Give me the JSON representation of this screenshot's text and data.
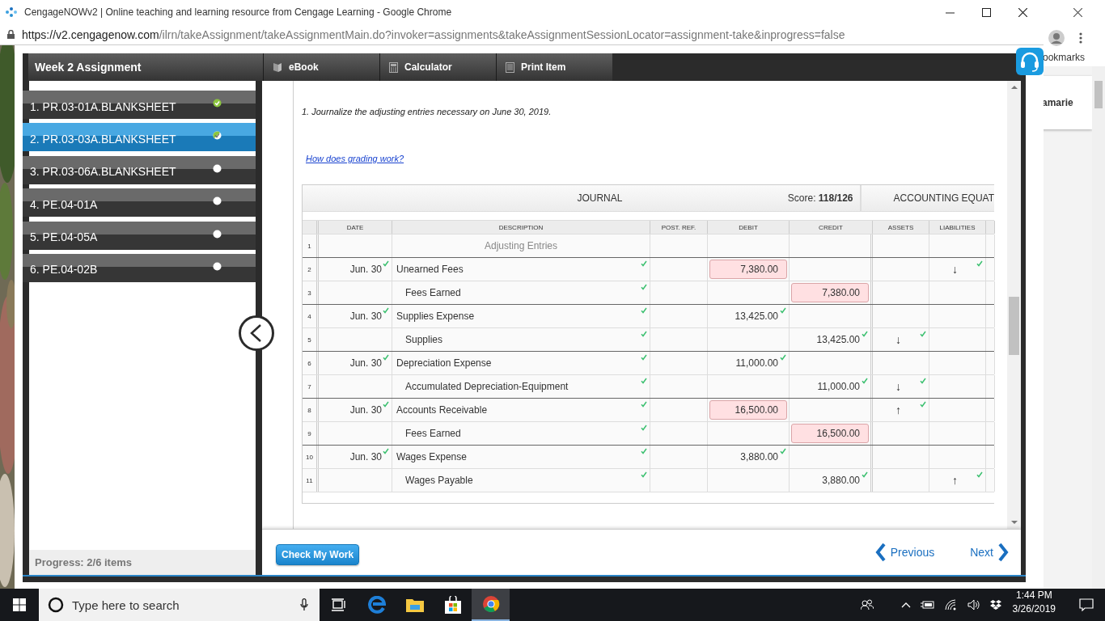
{
  "window": {
    "title": "CengageNOWv2 | Online teaching and learning resource from Cengage Learning - Google Chrome"
  },
  "address_bar": {
    "host": "https://v2.cengagenow.com",
    "path": "/ilrn/takeAssignment/takeAssignmentMain.do?invoker=assignments&takeAssignmentSessionLocator=assignment-take&inprogress=false"
  },
  "background_window": {
    "bookmarks_label": "ookmarks",
    "card_text": "amarie"
  },
  "assignment": {
    "title": "Week 2 Assignment",
    "tools": [
      {
        "label": "eBook",
        "kind": "book"
      },
      {
        "label": "Calculator",
        "kind": "calculator"
      },
      {
        "label": "Print Item",
        "kind": "print"
      }
    ]
  },
  "sidebar": {
    "items": [
      {
        "label": "1. PR.03-01A.BLANKSHEET",
        "selected": false,
        "kind": "done"
      },
      {
        "label": "2. PR.03-03A.BLANKSHEET",
        "selected": true,
        "kind": "partial"
      },
      {
        "label": "3. PR.03-06A.BLANKSHEET",
        "selected": false,
        "kind": "open"
      },
      {
        "label": "4. PE.04-01A",
        "selected": false,
        "kind": "open"
      },
      {
        "label": "5. PE.04-05A",
        "selected": false,
        "kind": "open"
      },
      {
        "label": "6. PE.04-02B",
        "selected": false,
        "kind": "open"
      }
    ],
    "progress": "Progress: 2/6 items"
  },
  "question": {
    "instruction": "1. Journalize the adjusting entries necessary on June 30, 2019.",
    "help_link": "How does grading work?"
  },
  "journal": {
    "title": "JOURNAL",
    "score": "Score: **118/126**",
    "next_section": "ACCOUNTING EQUAT",
    "columns": [
      "DATE",
      "DESCRIPTION",
      "POST. REF.",
      "DEBIT",
      "CREDIT",
      "ASSETS",
      "LIABILITIES"
    ],
    "rows": [
      {
        "number": "1",
        "kind": "heading",
        "description": {
          "value": "Adjusting Entries"
        }
      },
      {
        "number": "2",
        "kind": "debit",
        "date": {
          "value": "Jun. 30",
          "correct": true
        },
        "description": {
          "value": "Unearned Fees",
          "correct": true
        },
        "debit": {
          "value": "7,380.00",
          "correct": false
        },
        "liabilities": {
          "value": "↓",
          "correct": true
        }
      },
      {
        "number": "3",
        "kind": "credit",
        "description": {
          "value": "Fees Earned",
          "correct": true
        },
        "credit": {
          "value": "7,380.00",
          "correct": false
        }
      },
      {
        "number": "4",
        "kind": "debit",
        "date": {
          "value": "Jun. 30",
          "correct": true
        },
        "description": {
          "value": "Supplies Expense",
          "correct": true
        },
        "debit": {
          "value": "13,425.00",
          "correct": true
        }
      },
      {
        "number": "5",
        "kind": "credit",
        "description": {
          "value": "Supplies",
          "correct": true
        },
        "credit": {
          "value": "13,425.00",
          "correct": true
        },
        "assets": {
          "value": "↓",
          "correct": true
        }
      },
      {
        "number": "6",
        "kind": "debit",
        "date": {
          "value": "Jun. 30",
          "correct": true
        },
        "description": {
          "value": "Depreciation Expense",
          "correct": true
        },
        "debit": {
          "value": "11,000.00",
          "correct": true
        }
      },
      {
        "number": "7",
        "kind": "credit",
        "description": {
          "value": "Accumulated Depreciation-Equipment",
          "correct": true
        },
        "credit": {
          "value": "11,000.00",
          "correct": true
        },
        "assets": {
          "value": "↓",
          "correct": true
        }
      },
      {
        "number": "8",
        "kind": "debit",
        "date": {
          "value": "Jun. 30",
          "correct": true
        },
        "description": {
          "value": "Accounts Receivable",
          "correct": true
        },
        "debit": {
          "value": "16,500.00",
          "correct": false
        },
        "assets": {
          "value": "↑",
          "correct": true
        }
      },
      {
        "number": "9",
        "kind": "credit",
        "description": {
          "value": "Fees Earned",
          "correct": true
        },
        "credit": {
          "value": "16,500.00",
          "correct": false
        }
      },
      {
        "number": "10",
        "kind": "debit",
        "date": {
          "value": "Jun. 30",
          "correct": true
        },
        "description": {
          "value": "Wages Expense",
          "correct": true
        },
        "debit": {
          "value": "3,880.00",
          "correct": true
        }
      },
      {
        "number": "11",
        "kind": "credit",
        "description": {
          "value": "Wages Payable",
          "correct": true
        },
        "credit": {
          "value": "3,880.00",
          "correct": true
        },
        "liabilities": {
          "value": "↑",
          "correct": true
        }
      }
    ]
  },
  "footer": {
    "check_button": "Check My Work",
    "previous": "Previous",
    "next": "Next"
  },
  "taskbar": {
    "search_placeholder": "Type here to search",
    "apps": [
      {
        "kind": "task_view",
        "selected": false
      },
      {
        "kind": "edge",
        "selected": false
      },
      {
        "kind": "explorer",
        "selected": false
      },
      {
        "kind": "store",
        "selected": false
      },
      {
        "kind": "chrome",
        "selected": true
      }
    ],
    "time": "1:44 PM",
    "date": "3/26/2019"
  }
}
